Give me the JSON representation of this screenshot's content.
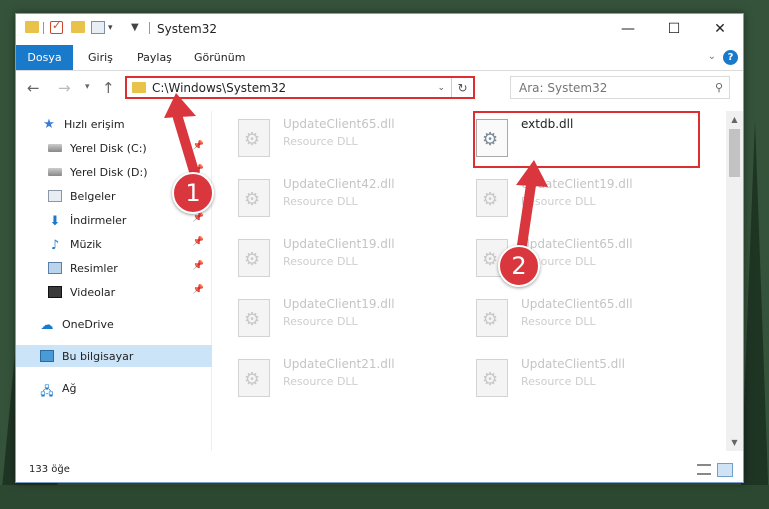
{
  "window": {
    "title": "System32"
  },
  "ribbon": {
    "tabs": [
      "Dosya",
      "Giriş",
      "Paylaş",
      "Görünüm"
    ],
    "help": "?"
  },
  "address": {
    "path": "C:\\Windows\\System32"
  },
  "search": {
    "placeholder": "Ara: System32"
  },
  "sidebar": {
    "items": [
      {
        "label": "Hızlı erişim",
        "icon": "star-icon",
        "pinned": false
      },
      {
        "label": "Yerel Disk (C:)",
        "icon": "drive-icon",
        "pinned": true
      },
      {
        "label": "Yerel Disk (D:)",
        "icon": "drive-icon",
        "pinned": true
      },
      {
        "label": "Belgeler",
        "icon": "documents-icon",
        "pinned": true
      },
      {
        "label": "İndirmeler",
        "icon": "downloads-icon",
        "pinned": true
      },
      {
        "label": "Müzik",
        "icon": "music-icon",
        "pinned": true
      },
      {
        "label": "Resimler",
        "icon": "pictures-icon",
        "pinned": true
      },
      {
        "label": "Videolar",
        "icon": "videos-icon",
        "pinned": true
      },
      {
        "label": "OneDrive",
        "icon": "cloud-icon",
        "pinned": false
      },
      {
        "label": "Bu bilgisayar",
        "icon": "computer-icon",
        "pinned": false,
        "selected": true
      },
      {
        "label": "Ağ",
        "icon": "network-icon",
        "pinned": false
      }
    ]
  },
  "files": {
    "left": [
      {
        "name": "UpdateClient65.dll",
        "type": "Resource DLL"
      },
      {
        "name": "UpdateClient42.dll",
        "type": "Resource DLL"
      },
      {
        "name": "UpdateClient19.dll",
        "type": "Resource DLL"
      },
      {
        "name": "UpdateClient19.dll",
        "type": "Resource DLL"
      },
      {
        "name": "UpdateClient21.dll",
        "type": "Resource DLL"
      }
    ],
    "right": [
      {
        "name": "extdb.dll",
        "type": ""
      },
      {
        "name": "UpdateClient19.dll",
        "type": "Resource DLL"
      },
      {
        "name": "UpdateClient65.dll",
        "type": "Resource DLL"
      },
      {
        "name": "UpdateClient65.dll",
        "type": "Resource DLL"
      },
      {
        "name": "UpdateClient5.dll",
        "type": "Resource DLL"
      }
    ]
  },
  "status": {
    "item_count": "133 öğe"
  },
  "annotations": {
    "step1": "1",
    "step2": "2",
    "color": "#d9363e"
  }
}
